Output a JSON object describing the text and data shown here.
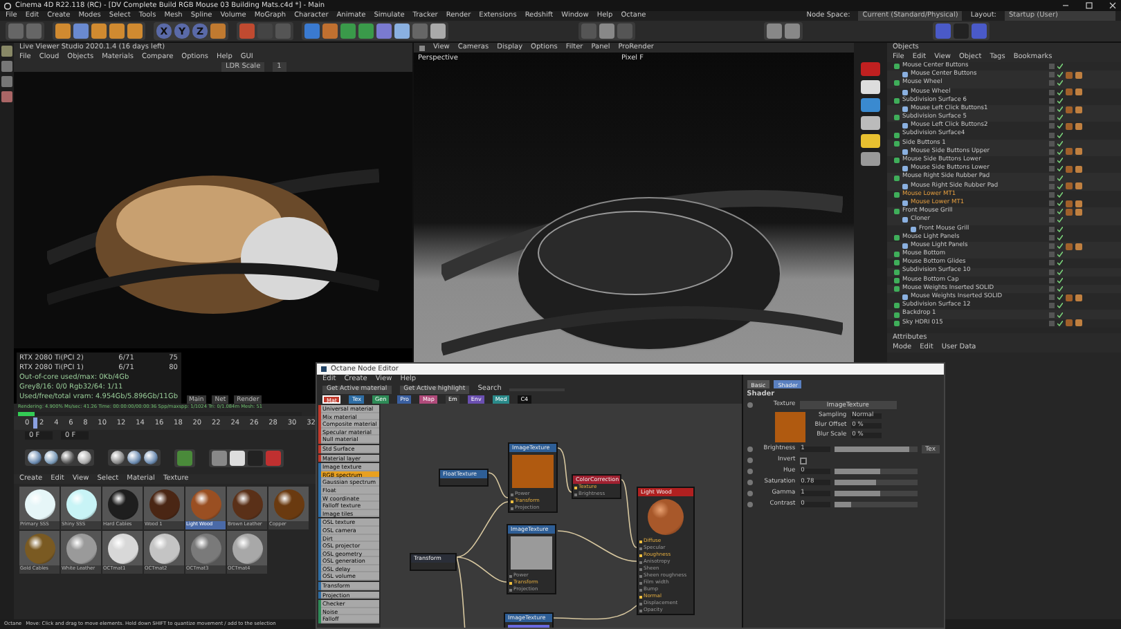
{
  "window": {
    "title": "Cinema 4D R22.118 (RC) - [DV Complete Build RGB Mouse 03 Building Mats.c4d *] - Main"
  },
  "menu": [
    "File",
    "Edit",
    "Create",
    "Modes",
    "Select",
    "Tools",
    "Mesh",
    "Spline",
    "Volume",
    "MoGraph",
    "Character",
    "Animate",
    "Simulate",
    "Tracker",
    "Render",
    "Extensions",
    "Redshift",
    "Window",
    "Help",
    "Octane"
  ],
  "node_space": {
    "label": "Node Space:",
    "value": "Current (Standard/Physical)"
  },
  "layout": {
    "label": "Layout:",
    "value": "Startup (User)"
  },
  "toolbar": {
    "axis_buttons": [
      "X",
      "Y",
      "Z"
    ]
  },
  "live_viewer": {
    "title": "Live Viewer Studio 2020.1.4 (16 days left)",
    "menu": [
      "File",
      "Cloud",
      "Objects",
      "Materials",
      "Compare",
      "Options",
      "Help",
      "GUI"
    ],
    "scale_label": "LDR Scale",
    "scale_value": "1",
    "stats": [
      [
        "RTX 2080 Ti(PCI 2)",
        "6/71",
        "75"
      ],
      [
        "RTX 2080 Ti(PCI 1)",
        "6/71",
        "80"
      ]
    ],
    "memory": [
      "Out-of-core used/max: 0Kb/4Gb",
      "Grey8/16: 0/0   Rgb32/64: 1/11",
      "Used/free/total vram: 4.954Gb/5.896Gb/11Gb"
    ],
    "buttons": [
      "Main",
      "Net",
      "Render"
    ],
    "rendering": "Rendering: 4.900%  Ms/sec: 41.26  Time: 00:00:00/00:00:36  Spp/maxspp: 1/1024  Tri: 0/1.084m  Mesh: 51",
    "progress": {
      "level": 0.06
    }
  },
  "timeline": {
    "ticks": [
      "0",
      "2",
      "4",
      "6",
      "8",
      "10",
      "12",
      "14",
      "16",
      "18",
      "20",
      "22",
      "24",
      "26",
      "28",
      "30",
      "32"
    ],
    "start": "0 F",
    "current": "0 F",
    "level": 0.05
  },
  "material_manager": {
    "menu": [
      "Create",
      "Edit",
      "View",
      "Select",
      "Material",
      "Texture"
    ],
    "materials": [
      {
        "name": "Primary SSS",
        "color": "#e6f6f8",
        "selected": false
      },
      {
        "name": "Shiny SSS",
        "color": "#c8f4f6",
        "selected": false
      },
      {
        "name": "Hard Cables",
        "color": "#1e1e1e",
        "selected": false
      },
      {
        "name": "Wood 1",
        "color": "#4a2614",
        "selected": false
      },
      {
        "name": "Light Wood",
        "color": "#9a4f22",
        "selected": true
      },
      {
        "name": "Brown Leather",
        "color": "#5a3018",
        "selected": false
      },
      {
        "name": "Copper",
        "color": "#6a3a10",
        "selected": false
      },
      {
        "name": "Gold Cables",
        "color": "#7a5a22",
        "selected": false
      },
      {
        "name": "White Leather",
        "color": "#9a9a9a",
        "selected": false
      },
      {
        "name": "OCTmat1",
        "color": "#d8d8d8",
        "selected": false
      },
      {
        "name": "OCTmat2",
        "color": "#c4c4c4",
        "selected": false
      },
      {
        "name": "OCTmat3",
        "color": "#7a7a7a",
        "selected": false
      },
      {
        "name": "OCTmat4",
        "color": "#a8a8a8",
        "selected": false
      }
    ]
  },
  "viewport": {
    "menu": [
      "View",
      "Cameras",
      "Display",
      "Options",
      "Filter",
      "Panel",
      "ProRender"
    ],
    "camera": "Perspective",
    "label": "Pixel F"
  },
  "objects": {
    "title": "Objects",
    "menu": [
      "File",
      "Edit",
      "View",
      "Object",
      "Tags",
      "Bookmarks"
    ],
    "tree": [
      {
        "name": "Mouse Center Buttons",
        "selected": false,
        "tagged": false,
        "children": [
          {
            "name": "Mouse Center Buttons",
            "selected": false,
            "tagged": true
          }
        ]
      },
      {
        "name": "Mouse Wheel",
        "selected": false,
        "tagged": false,
        "children": [
          {
            "name": "Mouse Wheel",
            "selected": false,
            "tagged": true
          }
        ]
      },
      {
        "name": "Subdivision Surface 6",
        "selected": false,
        "tagged": false,
        "children": [
          {
            "name": "Mouse Left Click Buttons1",
            "selected": false,
            "tagged": true
          }
        ]
      },
      {
        "name": "Subdivision Surface 5",
        "selected": false,
        "tagged": false,
        "children": [
          {
            "name": "Mouse Left Click Buttons2",
            "selected": false,
            "tagged": true
          }
        ]
      },
      {
        "name": "Subdivision Surface4",
        "selected": false,
        "tagged": false
      },
      {
        "name": "Side Buttons 1",
        "selected": false,
        "tagged": false,
        "children": [
          {
            "name": "Mouse Side Buttons Upper",
            "selected": false,
            "tagged": true
          }
        ]
      },
      {
        "name": "Mouse Side Buttons Lower",
        "selected": false,
        "tagged": false,
        "children": [
          {
            "name": "Mouse Side Buttons Lower",
            "selected": false,
            "tagged": true
          }
        ]
      },
      {
        "name": "Mouse Right Side Rubber Pad",
        "selected": false,
        "tagged": false,
        "children": [
          {
            "name": "Mouse Right Side Rubber Pad",
            "selected": false,
            "tagged": true
          }
        ]
      },
      {
        "name": "Mouse Lower MT1",
        "selected": true,
        "tagged": false,
        "children": [
          {
            "name": "Mouse Lower MT1",
            "selected": true,
            "tagged": true
          }
        ]
      },
      {
        "name": "Front Mouse Grill",
        "selected": false,
        "tagged": true,
        "children": [
          {
            "name": "Cloner",
            "selected": false,
            "tagged": false,
            "children": [
              {
                "name": "Front Mouse Grill",
                "selected": false,
                "tagged": false
              }
            ]
          }
        ]
      },
      {
        "name": "Mouse Light Panels",
        "selected": false,
        "tagged": false,
        "children": [
          {
            "name": "Mouse Light Panels",
            "selected": false,
            "tagged": true
          }
        ]
      },
      {
        "name": "Mouse Bottom",
        "selected": false,
        "tagged": false
      },
      {
        "name": "Mouse Bottom Glides",
        "selected": false,
        "tagged": false
      },
      {
        "name": "Subdivision Surface 10",
        "selected": false,
        "tagged": false
      },
      {
        "name": "Mouse Bottom Cap",
        "selected": false,
        "tagged": false
      },
      {
        "name": "Mouse Weights Inserted SOLID",
        "selected": false,
        "tagged": false,
        "children": [
          {
            "name": "Mouse Weights Inserted SOLID",
            "selected": false,
            "tagged": true
          }
        ]
      },
      {
        "name": "Subdivision Surface 12",
        "selected": false,
        "tagged": false
      },
      {
        "name": "Backdrop 1",
        "selected": false,
        "tagged": false
      },
      {
        "name": "Sky HDRI 015",
        "selected": false,
        "tagged": true
      }
    ]
  },
  "attributes": {
    "title": "Attributes",
    "menu": [
      "Mode",
      "Edit",
      "User Data"
    ]
  },
  "node_editor": {
    "title": "Octane Node Editor",
    "menu": [
      "Edit",
      "Create",
      "View",
      "Help"
    ],
    "buttons": [
      "Get Active material",
      "Get Active highlight"
    ],
    "search_label": "Search",
    "tabs": [
      {
        "label": "Mat",
        "color": "#c0392b",
        "selected": true
      },
      {
        "label": "Tex",
        "color": "#2e6da4",
        "selected": false
      },
      {
        "label": "Gen",
        "color": "#2e8b57",
        "selected": false
      },
      {
        "label": "Pro",
        "color": "#3a5fa0",
        "selected": false
      },
      {
        "label": "Map",
        "color": "#b04a7a",
        "selected": false
      },
      {
        "label": "Em",
        "color": "#3a3a3a",
        "selected": false
      },
      {
        "label": "Env",
        "color": "#6a4fb0",
        "selected": false
      },
      {
        "label": "Med",
        "color": "#2a8a8a",
        "selected": false
      },
      {
        "label": "C4",
        "color": "#111111",
        "selected": false
      }
    ],
    "groups": [
      {
        "color": "#c0392b",
        "items": [
          {
            "label": "Universal material",
            "selected": false
          },
          {
            "label": "Mix material",
            "selected": false
          },
          {
            "label": "Composite material",
            "selected": false
          },
          {
            "label": "Specular material",
            "selected": false
          },
          {
            "label": "Null material",
            "selected": false
          }
        ]
      },
      {
        "color": "#c0392b",
        "items": [
          {
            "label": "Std Surface",
            "selected": false
          }
        ]
      },
      {
        "color": "#c0392b",
        "items": [
          {
            "label": "Material layer",
            "selected": false
          }
        ]
      },
      {
        "color": "#2e6da4",
        "items": [
          {
            "label": "Image texture",
            "selected": false
          },
          {
            "label": "RGB spectrum",
            "selected": true
          },
          {
            "label": "Gaussian spectrum",
            "selected": false
          },
          {
            "label": "Float",
            "selected": false
          },
          {
            "label": "W coordinate",
            "selected": false
          },
          {
            "label": "Falloff texture",
            "selected": false
          },
          {
            "label": "Image tiles",
            "selected": false
          }
        ]
      },
      {
        "color": "#2e6da4",
        "items": [
          {
            "label": "OSL texture",
            "selected": false
          },
          {
            "label": "OSL camera",
            "selected": false
          },
          {
            "label": "Dirt",
            "selected": false
          },
          {
            "label": "OSL projector",
            "selected": false
          },
          {
            "label": "OSL geometry",
            "selected": false
          },
          {
            "label": "OSL generation",
            "selected": false
          },
          {
            "label": "OSL delay",
            "selected": false
          },
          {
            "label": "OSL volume",
            "selected": false
          }
        ]
      },
      {
        "color": "#2e6da4",
        "items": [
          {
            "label": "Transform",
            "selected": false
          }
        ]
      },
      {
        "color": "#2e6da4",
        "items": [
          {
            "label": "Projection",
            "selected": false
          }
        ]
      },
      {
        "color": "#2e8b57",
        "items": [
          {
            "label": "Checker",
            "selected": false
          },
          {
            "label": "Noise",
            "selected": false
          },
          {
            "label": "Falloff",
            "selected": false
          }
        ]
      }
    ],
    "nodes": [
      {
        "title": "FloatTexture",
        "color": "#2e5e96"
      },
      {
        "title": "ImageTexture",
        "color": "#2e5e96",
        "preview": {
          "color": "#b05a10"
        },
        "ports": [
          {
            "label": "Power",
            "linked": false
          },
          {
            "label": "Transform",
            "linked": true
          },
          {
            "label": "Projection",
            "linked": false
          }
        ]
      },
      {
        "title": "ColorCorrection",
        "color": "#a02030",
        "ports": [
          {
            "label": "Texture",
            "linked": true
          },
          {
            "label": "Brightness",
            "linked": false
          }
        ]
      },
      {
        "title": "Light Wood",
        "color": "#b02020",
        "preview": {
          "color": "#a8582a"
        },
        "ports": [
          {
            "label": "Diffuse",
            "linked": true
          },
          {
            "label": "Specular",
            "linked": false
          },
          {
            "label": "Roughness",
            "linked": true
          },
          {
            "label": "Anisotropy",
            "linked": false
          },
          {
            "label": "Sheen",
            "linked": false
          },
          {
            "label": "Sheen roughness",
            "linked": false
          },
          {
            "label": "Film width",
            "linked": false
          },
          {
            "label": "Bump",
            "linked": false
          },
          {
            "label": "Normal",
            "linked": true
          },
          {
            "label": "Displacement",
            "linked": false
          },
          {
            "label": "Opacity",
            "linked": false
          }
        ]
      },
      {
        "title": "Transform",
        "color": "#2a2e38"
      },
      {
        "title": "ImageTexture",
        "color": "#2e5e96",
        "preview": {
          "color": "#9a9a9a"
        },
        "ports": [
          {
            "label": "Power",
            "linked": false
          },
          {
            "label": "Transform",
            "linked": true
          },
          {
            "label": "Projection",
            "linked": false
          }
        ]
      },
      {
        "title": "ImageTexture",
        "color": "#2e5e96",
        "preview": {
          "color": "#6a6ae0"
        }
      }
    ],
    "panel_tabs": [
      {
        "label": "Basic",
        "selected": false
      },
      {
        "label": "Shader",
        "selected": true
      }
    ],
    "panel_title": "Shader",
    "texture": {
      "label": "Texture",
      "value": "ImageTexture",
      "fields": [
        {
          "label": "Sampling",
          "value": "Normal"
        },
        {
          "label": "Blur Offset",
          "value": "0 %"
        },
        {
          "label": "Blur Scale",
          "value": "0 %"
        }
      ]
    },
    "params": [
      {
        "kind": "slider",
        "label": "Brightness",
        "value": "1",
        "level": 0.9,
        "button": "Tex"
      },
      {
        "kind": "check",
        "label": "Invert",
        "checked": false
      },
      {
        "kind": "slider",
        "label": "Hue",
        "value": "0",
        "level": 0.55
      },
      {
        "kind": "slider",
        "label": "Saturation",
        "value": "0.78",
        "level": 0.5
      },
      {
        "kind": "slider",
        "label": "Gamma",
        "value": "1",
        "level": 0.55
      },
      {
        "kind": "slider",
        "label": "Contrast",
        "value": "0",
        "level": 0.2
      }
    ]
  },
  "status_bar": {
    "mode": "Octane",
    "message": "Move: Click and drag to move elements. Hold down SHIFT to quantize movement / add to the selection"
  }
}
